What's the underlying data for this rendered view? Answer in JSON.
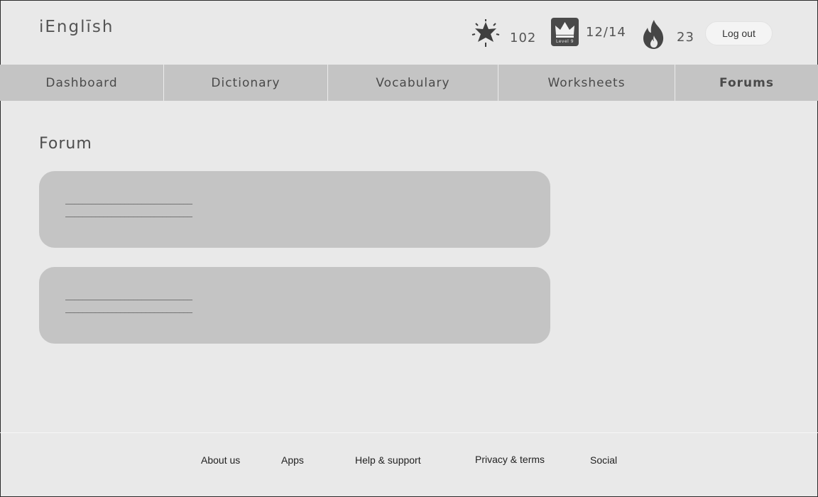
{
  "header": {
    "logo": "iEnglīsh",
    "xp_value": "102",
    "level_badge_text": "Level 9",
    "level_value": "12/14",
    "streak_value": "23",
    "logout_label": "Log out"
  },
  "nav": {
    "tabs": [
      {
        "label": "Dashboard"
      },
      {
        "label": "Dictionary"
      },
      {
        "label": "Vocabulary"
      },
      {
        "label": "Worksheets"
      },
      {
        "label": "Forums"
      }
    ]
  },
  "main": {
    "title": "Forum",
    "posts": [
      {
        "line1": "______________________________",
        "line2": "______________________________"
      },
      {
        "line1": "______________________________",
        "line2": "______________________________"
      }
    ]
  },
  "footer": {
    "links": [
      {
        "label": "About us"
      },
      {
        "label": "Apps"
      },
      {
        "label": "Help & support"
      },
      {
        "label": "Privacy & terms"
      },
      {
        "label": "Social"
      }
    ]
  },
  "icons": {
    "xp": "star-icon",
    "level": "crown-icon",
    "streak": "flame-icon"
  },
  "colors": {
    "background": "#e9e9e9",
    "nav_background": "#c4c4c4",
    "card_background": "#c4c4c4",
    "icon_color": "#4a4a4a"
  }
}
